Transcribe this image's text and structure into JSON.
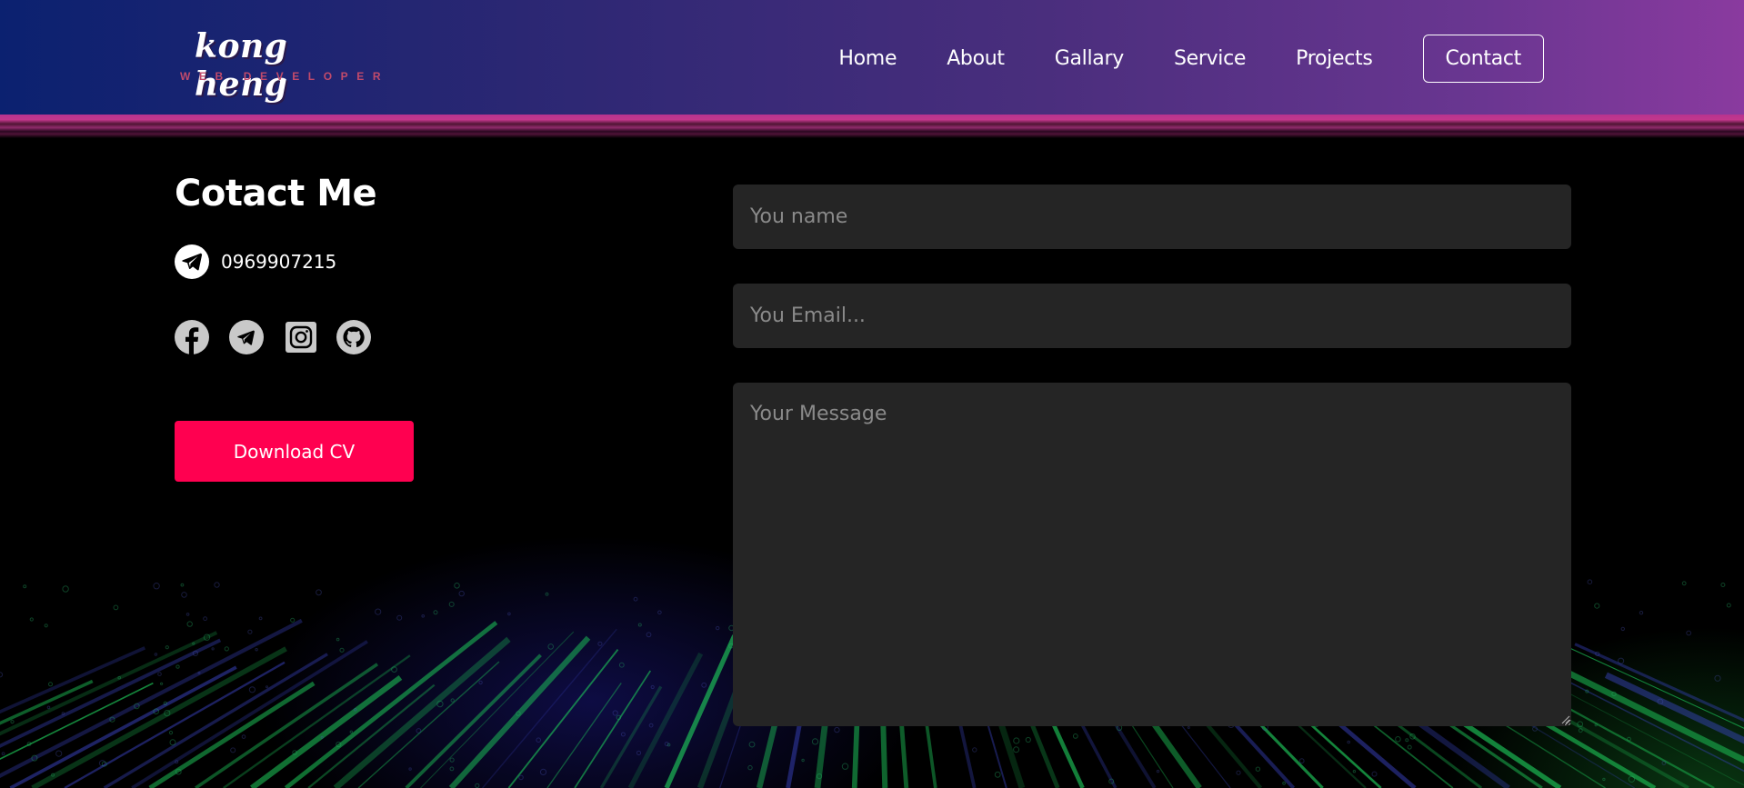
{
  "logo": {
    "name": "kong heng",
    "tagline": "WEB DEVELOPER"
  },
  "nav": {
    "items": [
      {
        "label": "Home"
      },
      {
        "label": "About"
      },
      {
        "label": "Gallary"
      },
      {
        "label": "Service"
      },
      {
        "label": "Projects"
      }
    ],
    "contact_label": "Contact"
  },
  "contact": {
    "title": "Cotact Me",
    "phone": "0969907215",
    "phone_icon": "telegram-icon",
    "socials": [
      {
        "icon": "facebook-icon"
      },
      {
        "icon": "telegram-icon"
      },
      {
        "icon": "instagram-icon"
      },
      {
        "icon": "github-icon"
      }
    ],
    "cv_button": "Download CV"
  },
  "form": {
    "name_placeholder": "You name",
    "email_placeholder": "You Email...",
    "message_placeholder": "Your Message"
  },
  "colors": {
    "accent": "#ff0050",
    "field_bg": "#252525",
    "header_start": "#0b2170",
    "header_end": "#8a3a9f"
  }
}
